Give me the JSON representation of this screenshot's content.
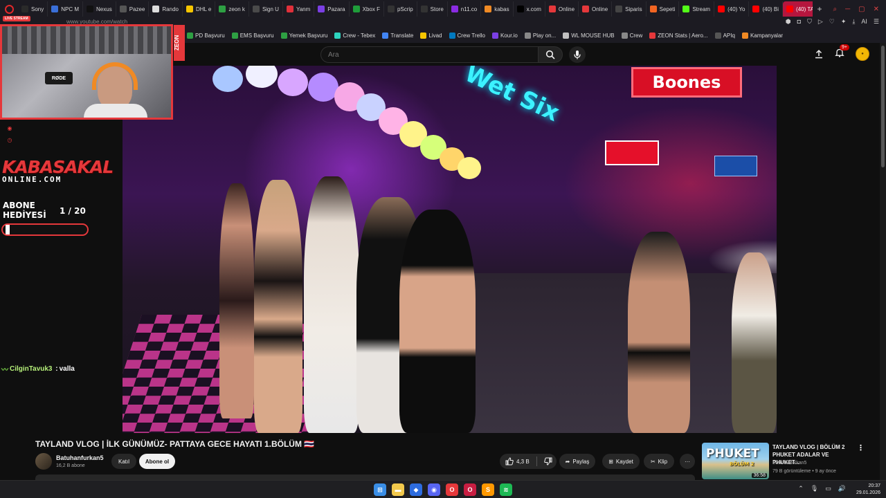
{
  "browser": {
    "tabs": [
      {
        "label": "Sony",
        "color": "#2a2a2a",
        "active": false
      },
      {
        "label": "NPC M",
        "color": "#3a6fd8",
        "active": false
      },
      {
        "label": "Nexus",
        "color": "#111111",
        "active": false
      },
      {
        "label": "Pazee",
        "color": "#555555",
        "active": false
      },
      {
        "label": "Rando",
        "color": "#dddddd",
        "active": false
      },
      {
        "label": "DHL e",
        "color": "#f6c500",
        "active": false
      },
      {
        "label": "zeon k",
        "color": "#2ea043",
        "active": false
      },
      {
        "label": "Sign U",
        "color": "#4a4a4a",
        "active": false
      },
      {
        "label": "Yanm",
        "color": "#e0303a",
        "active": false
      },
      {
        "label": "Pazara",
        "color": "#7b3fe4",
        "active": false
      },
      {
        "label": "Xbox F",
        "color": "#1f9d3a",
        "active": false
      },
      {
        "label": "pScrip",
        "color": "#333333",
        "active": false
      },
      {
        "label": "Store",
        "color": "#333333",
        "active": false
      },
      {
        "label": "n11.co",
        "color": "#8a2be2",
        "active": false
      },
      {
        "label": "kabas",
        "color": "#f08a24",
        "active": false
      },
      {
        "label": "x.com",
        "color": "#000000",
        "active": false
      },
      {
        "label": "Online",
        "color": "#e5383b",
        "active": false
      },
      {
        "label": "Online",
        "color": "#e5383b",
        "active": false
      },
      {
        "label": "Siparis",
        "color": "#444444",
        "active": false
      },
      {
        "label": "Sepeti",
        "color": "#f26522",
        "active": false
      },
      {
        "label": "Stream",
        "color": "#53fc18",
        "active": false
      },
      {
        "label": "(40) Yo",
        "color": "#ff0000",
        "active": false
      },
      {
        "label": "(40) Bi",
        "color": "#ff0000",
        "active": false
      },
      {
        "label": "(40) TAYL",
        "color": "#ff0000",
        "active": true
      }
    ],
    "url": "www.youtube.com/watch",
    "bookmarks": [
      {
        "label": "PD Başvuru",
        "color": "#2ea043"
      },
      {
        "label": "EMS Başvuru",
        "color": "#2ea043"
      },
      {
        "label": "Yemek Başvuru",
        "color": "#2ea043"
      },
      {
        "label": "Crew - Tebex",
        "color": "#2dd4bf"
      },
      {
        "label": "Translate",
        "color": "#4285f4"
      },
      {
        "label": "Livad",
        "color": "#f6c500"
      },
      {
        "label": "Crew Trello",
        "color": "#0079bf"
      },
      {
        "label": "Kour.io",
        "color": "#7b3fe4"
      },
      {
        "label": "Play on...",
        "color": "#888888"
      },
      {
        "label": "WL MOUSE HUB",
        "color": "#c0c0c0"
      },
      {
        "label": "Crew",
        "color": "#888888"
      },
      {
        "label": "ZEON Stats | Aero...",
        "color": "#e5383b"
      },
      {
        "label": "APIq",
        "color": "#555555"
      },
      {
        "label": "Kampanyalar",
        "color": "#f08a24"
      }
    ]
  },
  "youtube": {
    "search_placeholder": "Ara",
    "notification_count": "9+",
    "video_title": "TAYLAND VLOG | İLK GÜNÜMÜZ- PATTAYA GECE HAYATI 1.BÖLÜM 🇹🇭",
    "video_title_flag": "TH",
    "channel_name": "Batuhanfurkan5",
    "subscribers": "16,2 B abone",
    "join_label": "Katıl",
    "subscribe_label": "Abone ol",
    "like_count": "4,3 B",
    "share_label": "Paylaş",
    "save_label": "Kaydet",
    "clip_label": "Klip",
    "more_label": "···",
    "related": {
      "title": "TAYLAND VLOG | BÖLÜM 2 PHUKET ADALAR VE PHUKET...",
      "channel": "Batuhanfurkan5",
      "meta": "79 B görüntüleme • 9 ay önce",
      "duration": "36:58",
      "thumb_text_1": "PHUKET",
      "thumb_text_2": "BÖLÜM 2"
    },
    "video_signs": {
      "boones": "Boones",
      "wet": "Wet Six"
    }
  },
  "overlay": {
    "live_tag": "LIVE STREAM",
    "mic_brand": "RØDE",
    "side_strip": "ZEON",
    "brand_line1": "KABASAKAL",
    "brand_line2": "ONLINE.COM",
    "goal_label_1": "ABONE",
    "goal_label_2": "HEDİYESİ",
    "goal_count": "1 / 20",
    "goal_progress": 0.05,
    "chat_user": "CilginTavuk3",
    "chat_message": "valla",
    "accent": "#e5383b"
  },
  "taskbar": {
    "time": "20:37",
    "date": "29.01.2026",
    "apps": [
      {
        "name": "windows-start-icon",
        "color": "#3a8ee6",
        "glyph": "⊞"
      },
      {
        "name": "file-explorer-icon",
        "color": "#f2c94c",
        "glyph": "▬"
      },
      {
        "name": "app-icon",
        "color": "#2d6cdf",
        "glyph": "◆"
      },
      {
        "name": "discord-icon",
        "color": "#5865f2",
        "glyph": "◉"
      },
      {
        "name": "opera-icon",
        "color": "#e5383b",
        "glyph": "O"
      },
      {
        "name": "opera-gx-icon",
        "color": "#c81e42",
        "glyph": "O"
      },
      {
        "name": "sublime-icon",
        "color": "#ff9800",
        "glyph": "S"
      },
      {
        "name": "spotify-icon",
        "color": "#1db954",
        "glyph": "≋"
      }
    ]
  }
}
